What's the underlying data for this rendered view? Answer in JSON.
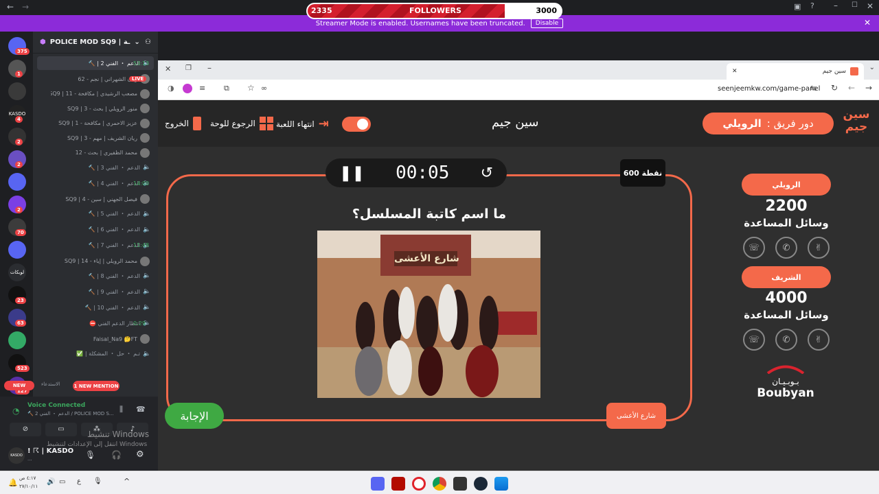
{
  "followers": {
    "current": "2335",
    "label": "FOLLOWERS",
    "goal": "3000",
    "fill": 0.777
  },
  "banner": {
    "text": "Streamer Mode is enabled. Usernames have been truncated.",
    "disable_label": "Disable"
  },
  "servers": [
    {
      "badge": "375"
    },
    {
      "badge": "1"
    },
    {
      "badge": ""
    },
    {
      "label": "KASDO",
      "badge": "4"
    },
    {
      "badge": "2"
    },
    {
      "badge": "2"
    },
    {
      "badge": ""
    },
    {
      "badge": "2"
    },
    {
      "badge": "70"
    },
    {
      "badge": ""
    },
    {
      "label": "لوبكات",
      "badge": ""
    },
    {
      "badge": "23"
    },
    {
      "badge": "63"
    },
    {
      "badge": ""
    },
    {
      "badge": "523"
    },
    {
      "badge": "127"
    }
  ],
  "new_label": "NEW",
  "server": {
    "name": "POLICE MOD SQ9 | ـة"
  },
  "channels": [
    {
      "name": "الدعم ・ الفني 2 | 🔨",
      "time": "53:13",
      "active": true
    },
    {
      "name": "ريان الشهراني | نجم - 62",
      "user": true,
      "live": "LIVE"
    },
    {
      "name": "مصعب الرشيدي | مكافحة - 11 | SQ9",
      "user": true
    },
    {
      "name": "منور الرويلي | بحث - 3 | SQ9",
      "user": true
    },
    {
      "name": "عزيز الاحمري | مكافحة - 1 | SQ9",
      "user": true
    },
    {
      "name": "ريان الشريف | مهم - 3 | SQ9",
      "user": true
    },
    {
      "name": "محمد الظفيري | بحث - 12",
      "user": true
    },
    {
      "name": "الدعم ・ الفني 3 | 🔨"
    },
    {
      "name": "الدعم ・ الفني 4 | 🔨",
      "time": "14:00"
    },
    {
      "name": "فيصل الجهني | سين - 4 | SQ9",
      "user": true
    },
    {
      "name": "الدعم ・ الفني 5 | 🔨"
    },
    {
      "name": "الدعم ・ الفني 6 | 🔨"
    },
    {
      "name": "الدعم ・ الفني 7 | 🔨",
      "time": "11:48"
    },
    {
      "name": "محمد الرويلي | إياء - 14 | SQ9",
      "user": true
    },
    {
      "name": "الدعم ・ الفني 8 | 🔨"
    },
    {
      "name": "الدعم ・ الفني 9 | 🔨"
    },
    {
      "name": "الدعم ・ الفني 10 | 🔨"
    },
    {
      "name": "انتظار الدعم الفني ⛔",
      "time": "0:29"
    },
    {
      "name": "Faisal_Na9 🤔FT",
      "user": true
    },
    {
      "name": "تـم ・ حل ・ المشكلة | ✅"
    }
  ],
  "channels_footer": {
    "summon": "الاستدعاء",
    "mention": "1 NEW MENTION"
  },
  "voice": {
    "status": "Voice Connected",
    "channel": "🔨 الدعم ・ الفني 2 / POLICE MOD S..."
  },
  "user": {
    "name": "! ☈ | KASDO",
    "sub": "..."
  },
  "watermark": {
    "line1": "تنشيط Windows",
    "line2": "انتقل إلى الإعدادات لتنشيط Windows"
  },
  "browser": {
    "tab_title": "سين جيم",
    "url": "seenjeemkw.com/game-panel"
  },
  "game": {
    "team_turn_label": "دور فريق :",
    "team_turn_name": "الرويلي",
    "title": "سين جيم",
    "end_game": "انتهاء اللعبة",
    "back_to_board": "الرجوع للوحة",
    "exit": "الخروج",
    "timer": "00:05",
    "points": "600 نقطة",
    "question": "ما اسم كاتبة المسلسل؟",
    "answer_button": "الإجابة",
    "hint": "شارع الأعشى",
    "sign_text": "شارع الأعشى",
    "teams": [
      {
        "name": "الرويلي",
        "score": "2200",
        "aids_label": "وسائل المساعدة"
      },
      {
        "name": "الشريف",
        "score": "4000",
        "aids_label": "وسائل المساعدة"
      }
    ],
    "sponsor": "Boubyan",
    "sponsor_ar": "بـوبـيـان"
  },
  "taskbar": {
    "time": "٤:١٧ ص",
    "date": "٢٧/١٠/١١",
    "lang": "ع"
  }
}
